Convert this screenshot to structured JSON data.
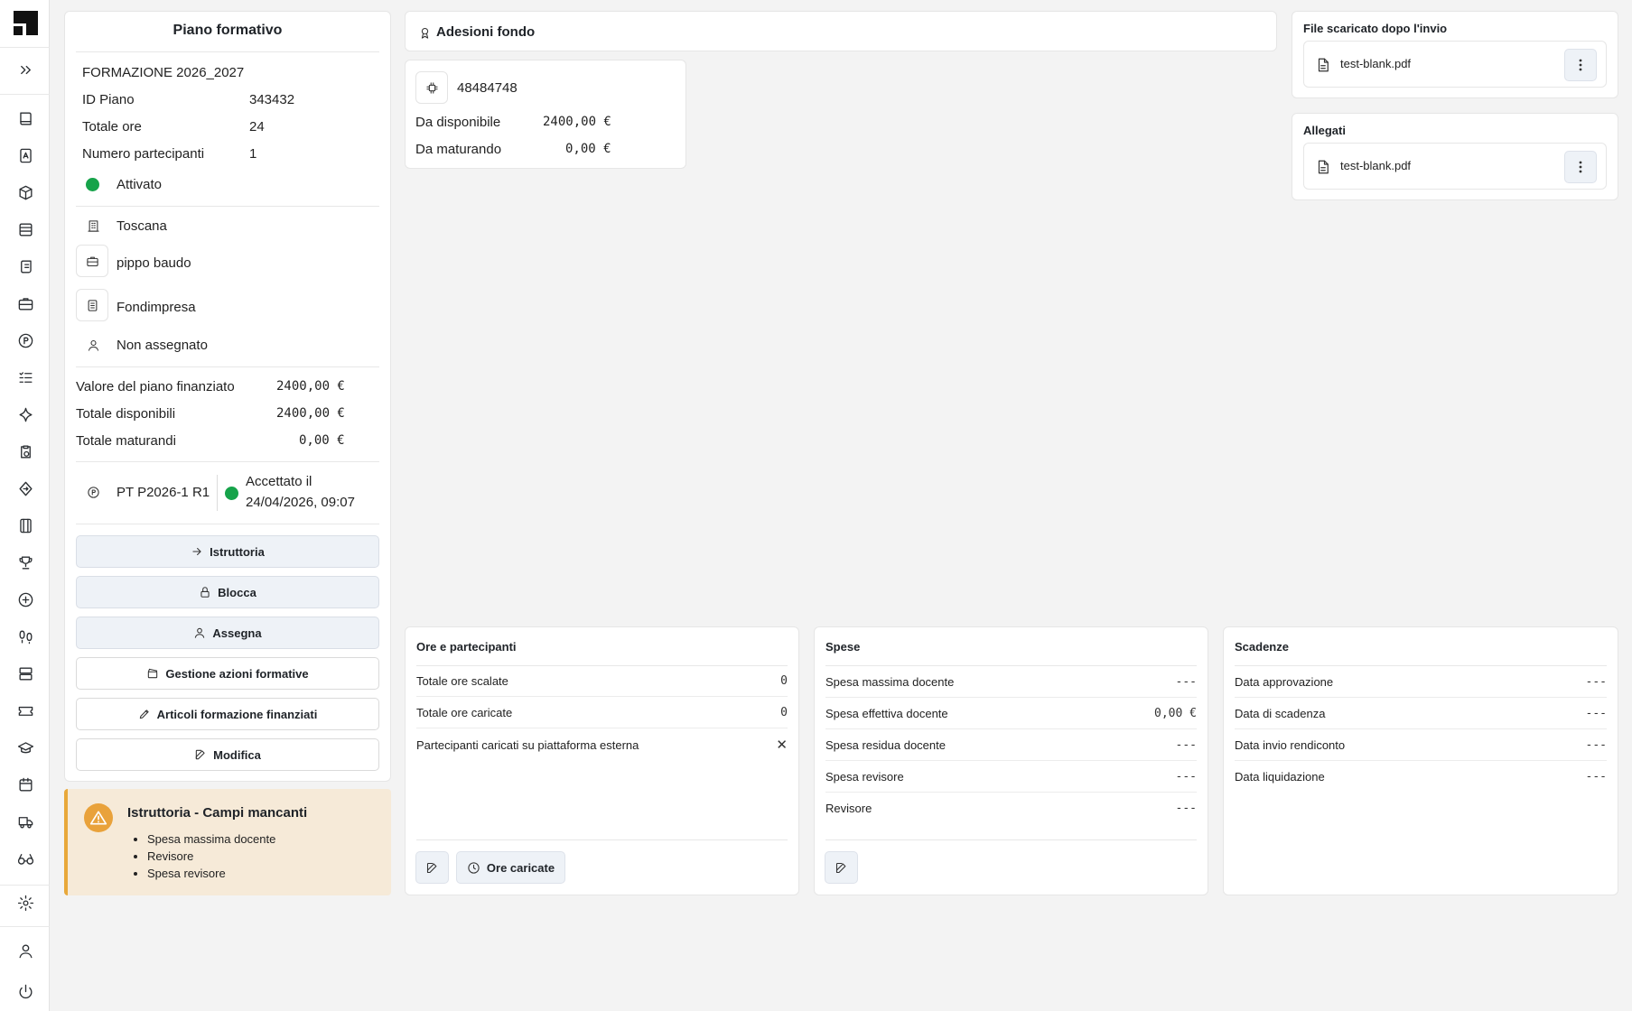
{
  "sidebar": {
    "items": [
      "expand-icon",
      "book-icon",
      "contact-book-icon",
      "package-icon",
      "database-icon",
      "scroll-icon",
      "briefcase-icon",
      "parking-icon",
      "list-check-icon",
      "sparkle-icon",
      "clipboard-clock-icon",
      "route-icon",
      "film-icon",
      "trophy-icon",
      "plus-circle-icon",
      "footprints-icon",
      "server-icon",
      "ticket-icon",
      "graduation-cap-icon",
      "calendar-icon",
      "truck-icon",
      "glasses-icon",
      "settings-icon",
      "user-icon",
      "power-icon"
    ]
  },
  "piano": {
    "title": "Piano formativo",
    "name": "FORMAZIONE 2026_2027",
    "id_label": "ID Piano",
    "id_value": "343432",
    "ore_label": "Totale ore",
    "ore_value": "24",
    "partecipanti_label": "Numero partecipanti",
    "partecipanti_value": "1",
    "status": "Attivato",
    "status_color": "#16a34a",
    "regione": "Toscana",
    "azienda": "pippo baudo",
    "fondo": "Fondimpresa",
    "assegnatario": "Non assegnato",
    "valore_label": "Valore del piano finanziato",
    "valore_value": "2400,00 €",
    "disponibili_label": "Totale disponibili",
    "disponibili_value": "2400,00 €",
    "maturandi_label": "Totale maturandi",
    "maturandi_value": "0,00 €",
    "pt_code": "PT P2026-1 R1",
    "pt_status_line1": "Accettato il",
    "pt_status_line2": "24/04/2026, 09:07"
  },
  "actions": {
    "istruttoria": "Istruttoria",
    "blocca": "Blocca",
    "assegna": "Assegna",
    "gestione": "Gestione azioni formative",
    "articoli": "Articoli formazione finanziati",
    "modifica": "Modifica"
  },
  "warning": {
    "title": "Istruttoria - Campi mancanti",
    "items": [
      "Spesa massima docente",
      "Revisore",
      "Spesa revisore"
    ],
    "accent": "#e9a23b"
  },
  "adesioni": {
    "title": "Adesioni fondo",
    "code": "48484748",
    "disponibile_label": "Da disponibile",
    "disponibile_value": "2400,00 €",
    "maturando_label": "Da maturando",
    "maturando_value": "0,00 €"
  },
  "files": {
    "scaricato_title": "File scaricato dopo l'invio",
    "scaricato_name": "test-blank.pdf",
    "allegati_title": "Allegati",
    "allegati_name": "test-blank.pdf"
  },
  "ore": {
    "title": "Ore e partecipanti",
    "rows": [
      {
        "label": "Totale ore scalate",
        "value": "0"
      },
      {
        "label": "Totale ore caricate",
        "value": "0"
      },
      {
        "label": "Partecipanti caricati su piattaforma esterna",
        "value": "✕"
      }
    ],
    "ore_caricate_button": "Ore caricate"
  },
  "spese": {
    "title": "Spese",
    "rows": [
      {
        "label": "Spesa massima docente",
        "value": "---"
      },
      {
        "label": "Spesa effettiva docente",
        "value": "0,00 €"
      },
      {
        "label": "Spesa residua docente",
        "value": "---"
      },
      {
        "label": "Spesa revisore",
        "value": "---"
      },
      {
        "label": "Revisore",
        "value": "---"
      }
    ]
  },
  "scadenze": {
    "title": "Scadenze",
    "rows": [
      {
        "label": "Data approvazione",
        "value": "---"
      },
      {
        "label": "Data di scadenza",
        "value": "---"
      },
      {
        "label": "Data invio rendiconto",
        "value": "---"
      },
      {
        "label": "Data liquidazione",
        "value": "---"
      }
    ]
  }
}
